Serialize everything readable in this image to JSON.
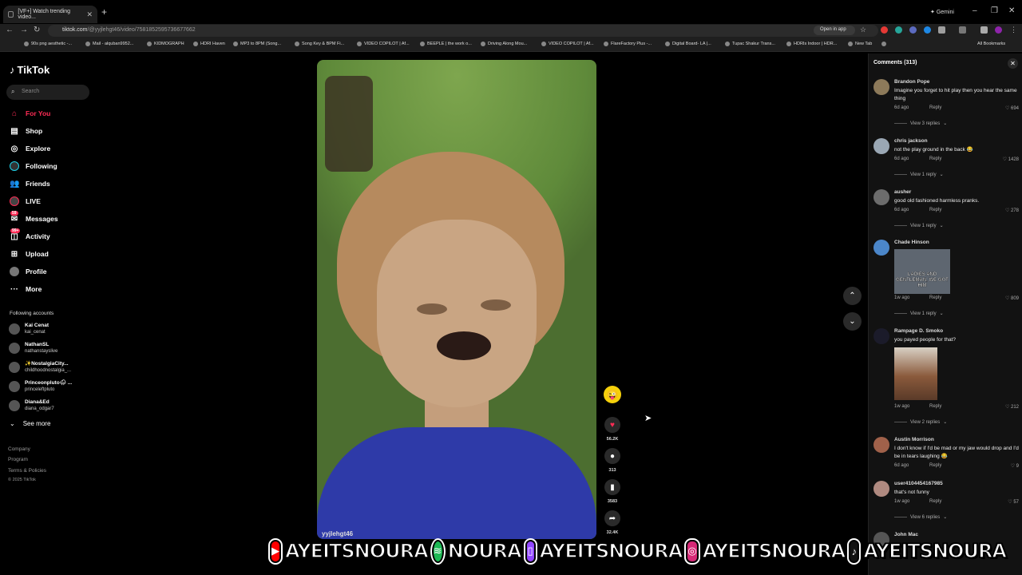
{
  "browser": {
    "tab_title": "[VF+] Watch trending video...",
    "gemini_label": "Gemini",
    "url_host": "tiktok.com",
    "url_path": "/@yyjlehgt46/video/7581852595736677662",
    "open_in_app": "Open in app",
    "all_bookmarks": "All Bookmarks",
    "bookmarks": [
      "90s png aesthetic -...",
      "Mail - alquban9952...",
      "KIDMOGRAPH",
      "HDRI Haven",
      "MP3 to 8PM (Song...",
      "Song Key & BPM Fi...",
      "VIDEO COPILOT | Af...",
      "BEEPLE | the work o...",
      "Driving Along Mou...",
      "VIDEO COPILOT | Af...",
      "FlareFactory Plus -...",
      "Digital Board- LA |...",
      "Tupac Shakur Trans...",
      "HDRIs Indoor | HDR...",
      "New Tab"
    ]
  },
  "sidebar": {
    "logo": "TikTok",
    "search_placeholder": "Search",
    "items": [
      {
        "label": "For You"
      },
      {
        "label": "Shop"
      },
      {
        "label": "Explore"
      },
      {
        "label": "Following"
      },
      {
        "label": "Friends"
      },
      {
        "label": "LIVE"
      },
      {
        "label": "Messages",
        "badge": "59"
      },
      {
        "label": "Activity",
        "badge": "99+"
      },
      {
        "label": "Upload"
      },
      {
        "label": "Profile"
      },
      {
        "label": "More"
      }
    ],
    "following_header": "Following accounts",
    "accounts": [
      {
        "name": "Kai Cenat",
        "handle": "kai_cenat"
      },
      {
        "name": "NathanSL",
        "handle": "nathanstayslive"
      },
      {
        "name": "✨NostalgiaCity...",
        "handle": "childhoodnostalgia_..."
      },
      {
        "name": "Princeonpluto🌧 ...",
        "handle": "princeleftpluto"
      },
      {
        "name": "Diana&Ed",
        "handle": "diana_odgar7"
      }
    ],
    "see_more": "See more",
    "footer": [
      "Company",
      "Program",
      "Terms & Policies",
      "© 2025 TikTok"
    ]
  },
  "video": {
    "username": "yyjlehgt46",
    "likes": "56.2K",
    "comments": "313",
    "saves": "3583",
    "shares": "32.4K"
  },
  "comments_panel": {
    "title": "Comments (313)",
    "comments": [
      {
        "user": "Brandon Pope",
        "text": "Imagine you forget to hit play then you hear the same thing",
        "time": "6d ago",
        "reply": "Reply",
        "likes": "694",
        "view_replies": "View 3 replies"
      },
      {
        "user": "chris jackson",
        "text": "not the play ground in the back 😂",
        "time": "6d ago",
        "reply": "Reply",
        "likes": "1428",
        "view_replies": "View 1 reply"
      },
      {
        "user": "ausher",
        "text": "good old fashioned harmless pranks.",
        "time": "6d ago",
        "reply": "Reply",
        "likes": "278",
        "view_replies": "View 1 reply"
      },
      {
        "user": "Chade Hinson",
        "text": "",
        "image_caption": "LADIES AND GENTLEMAN, WE GOT HIM",
        "time": "1w ago",
        "reply": "Reply",
        "likes": "809",
        "view_replies": "View 1 reply"
      },
      {
        "user": "Rampage D. Smoko",
        "text": "you payed people for that?",
        "time": "1w ago",
        "reply": "Reply",
        "likes": "212",
        "view_replies": "View 2 replies"
      },
      {
        "user": "Austin Morrison",
        "text": "I don't know if I'd be mad or my jaw would drop and I'd be in tears laughing 😂",
        "time": "6d ago",
        "reply": "Reply",
        "likes": "9",
        "view_replies": ""
      },
      {
        "user": "user4104454167985",
        "text": "that's not funny",
        "time": "1w ago",
        "reply": "Reply",
        "likes": "57",
        "view_replies": "View 6 replies"
      },
      {
        "user": "John Mac",
        "text": "",
        "time": "",
        "reply": "",
        "likes": "",
        "view_replies": ""
      }
    ]
  },
  "overlay": {
    "handles": [
      {
        "icon": "youtube-icon",
        "text": "AYEITSNOURA",
        "color": "#ff0000"
      },
      {
        "icon": "spotify-icon",
        "text": "NOURA",
        "color": "#1db954"
      },
      {
        "icon": "twitch-icon",
        "text": "AYEITSNOURA",
        "color": "#9146ff"
      },
      {
        "icon": "instagram-icon",
        "text": "AYEITSNOURA",
        "color": "#d62976"
      },
      {
        "icon": "tiktok-icon",
        "text": "AYEITSNOURA",
        "color": "#111111"
      }
    ]
  }
}
